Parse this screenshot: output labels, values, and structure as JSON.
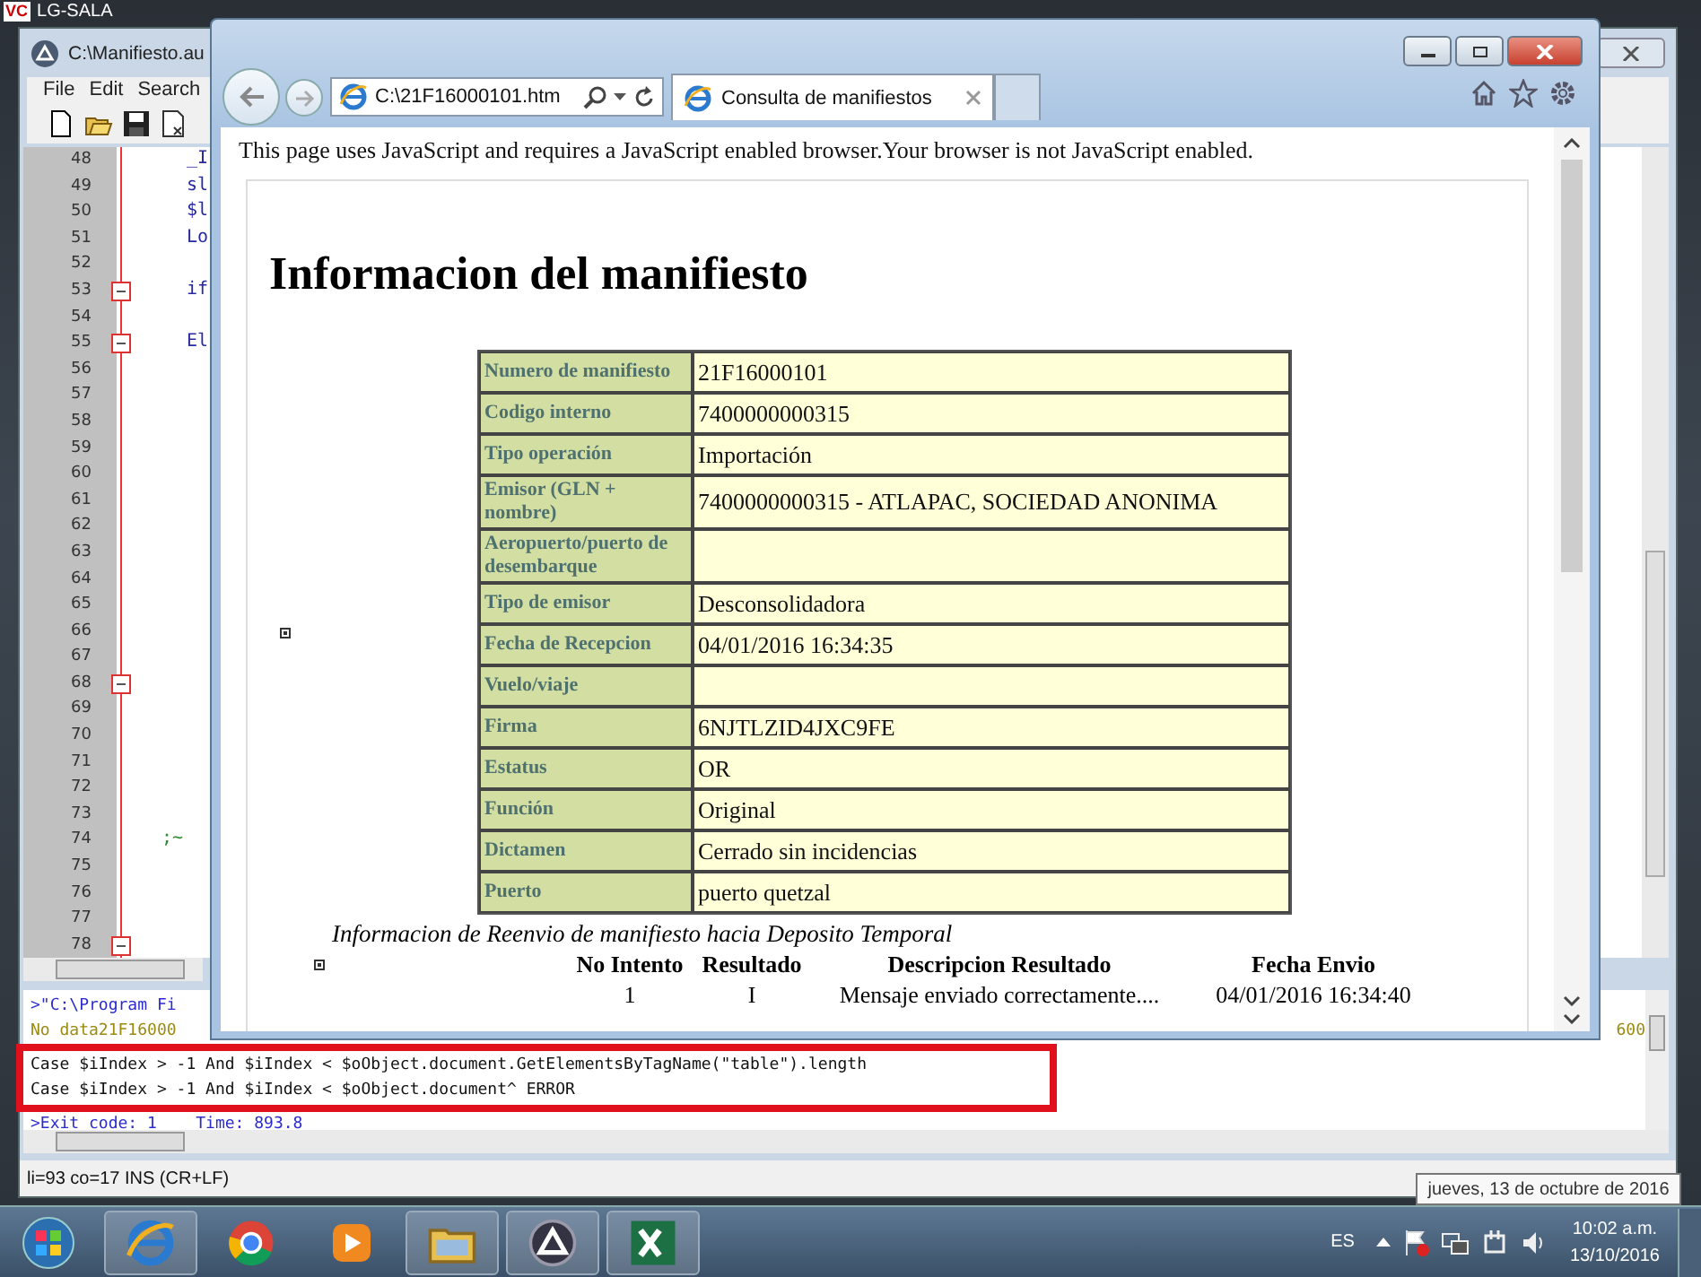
{
  "desktop_window": {
    "logo": "VC",
    "title": "LG-SALA"
  },
  "editor": {
    "title": "C:\\Manifiesto.au",
    "menu": [
      {
        "label": "File"
      },
      {
        "label": "Edit"
      },
      {
        "label": "Search"
      }
    ],
    "toolbar": [
      {
        "kind": "new"
      },
      {
        "kind": "open"
      },
      {
        "kind": "save"
      },
      {
        "kind": "close"
      }
    ],
    "lines": [
      {
        "number": "48",
        "code": "_I",
        "kind": "code",
        "fold": false
      },
      {
        "number": "49",
        "code": "sl",
        "kind": "code",
        "fold": false
      },
      {
        "number": "50",
        "code": "$l",
        "kind": "code",
        "fold": false
      },
      {
        "number": "51",
        "code": "Lo",
        "kind": "code",
        "fold": false
      },
      {
        "number": "52",
        "kind": "code",
        "fold": false
      },
      {
        "number": "53",
        "code": "if",
        "kind": "code",
        "fold": true
      },
      {
        "number": "54",
        "kind": "code",
        "fold": false
      },
      {
        "number": "55",
        "code": "El",
        "kind": "code",
        "fold": true
      },
      {
        "number": "56",
        "kind": "code",
        "fold": false
      },
      {
        "number": "57",
        "kind": "code",
        "fold": false
      },
      {
        "number": "58",
        "kind": "code",
        "fold": false
      },
      {
        "number": "59",
        "kind": "code",
        "fold": false
      },
      {
        "number": "60",
        "kind": "code",
        "fold": false
      },
      {
        "number": "61",
        "kind": "code",
        "fold": false
      },
      {
        "number": "62",
        "kind": "code",
        "fold": false
      },
      {
        "number": "63",
        "kind": "code",
        "fold": false
      },
      {
        "number": "64",
        "kind": "code",
        "fold": false
      },
      {
        "number": "65",
        "kind": "code",
        "fold": false
      },
      {
        "number": "66",
        "kind": "code",
        "fold": false
      },
      {
        "number": "67",
        "kind": "code",
        "fold": false
      },
      {
        "number": "68",
        "kind": "code",
        "fold": true
      },
      {
        "number": "69",
        "kind": "code",
        "fold": false
      },
      {
        "number": "70",
        "kind": "code",
        "fold": false
      },
      {
        "number": "71",
        "kind": "code",
        "fold": false
      },
      {
        "number": "72",
        "kind": "code",
        "fold": false
      },
      {
        "number": "73",
        "kind": "code",
        "fold": false
      },
      {
        "number": "74",
        "code": ";~",
        "kind": "comment",
        "fold": false
      },
      {
        "number": "75",
        "kind": "code",
        "fold": false
      },
      {
        "number": "76",
        "kind": "code",
        "fold": false
      },
      {
        "number": "77",
        "kind": "code",
        "fold": false
      },
      {
        "number": "78",
        "kind": "code",
        "fold": true
      }
    ],
    "output": [
      {
        "text": ">\"C:\\Program Fi",
        "kind": "command",
        "highlighted": false
      },
      {
        "text": "No data21F16000",
        "tail": "600",
        "kind": "warning",
        "highlighted": false
      },
      {
        "text": "Case $iIndex > -1 And $iIndex < $oObject.document.GetElementsByTagName(\"table\").length",
        "kind": "plain",
        "highlighted": true
      },
      {
        "text": "Case $iIndex > -1 And $iIndex < $oObject.document^ ERROR",
        "kind": "plain",
        "highlighted": true
      },
      {
        "text": ">Exit code: 1    Time: 893.8",
        "kind": "command",
        "highlighted": false
      }
    ],
    "status_bar": "li=93 co=17 INS (CR+LF)"
  },
  "browser": {
    "address": "C:\\21F16000101.htm",
    "tab": {
      "label": "Consulta de manifiestos",
      "selected": true
    },
    "notice": "This page uses JavaScript and requires a JavaScript enabled browser.Your browser is not JavaScript enabled.",
    "heading": "Informacion del manifiesto",
    "fields": [
      {
        "label": "Numero de manifiesto",
        "value": "21F16000101"
      },
      {
        "label": "Codigo interno",
        "value": "7400000000315"
      },
      {
        "label": "Tipo operación",
        "value": "Importación"
      },
      {
        "label": "Emisor (GLN + nombre)",
        "value": "7400000000315 - ATLAPAC, SOCIEDAD ANONIMA"
      },
      {
        "label": "Aeropuerto/puerto de desembarque"
      },
      {
        "label": "Tipo de emisor",
        "value": "Desconsolidadora"
      },
      {
        "label": "Fecha de Recepcion",
        "value": "04/01/2016 16:34:35"
      },
      {
        "label": "Vuelo/viaje"
      },
      {
        "label": "Firma",
        "value": "6NJTLZID4JXC9FE"
      },
      {
        "label": "Estatus",
        "value": "OR"
      },
      {
        "label": "Función",
        "value": "Original"
      },
      {
        "label": "Dictamen",
        "value": "Cerrado sin incidencias"
      },
      {
        "label": "Puerto",
        "value": "puerto quetzal"
      }
    ],
    "resend": {
      "caption": "Informacion de Reenvio de manifiesto hacia Deposito Temporal",
      "columns": [
        "No Intento",
        "Resultado",
        "Descripcion Resultado",
        "Fecha Envio"
      ],
      "rows": [
        [
          "1",
          "I",
          "Mensaje enviado correctamente....",
          "04/01/2016 16:34:40"
        ]
      ]
    }
  },
  "taskbar": {
    "apps": [
      {
        "kind": "ie",
        "running": true
      },
      {
        "kind": "chrome",
        "running": false
      },
      {
        "kind": "media",
        "running": false
      },
      {
        "kind": "folder",
        "running": true
      },
      {
        "kind": "autoit",
        "running": true
      },
      {
        "kind": "excel",
        "running": true
      }
    ],
    "language": "ES",
    "time": "10:02 a.m.",
    "date": "13/10/2016",
    "tooltip": "jueves, 13 de octubre de 2016"
  }
}
